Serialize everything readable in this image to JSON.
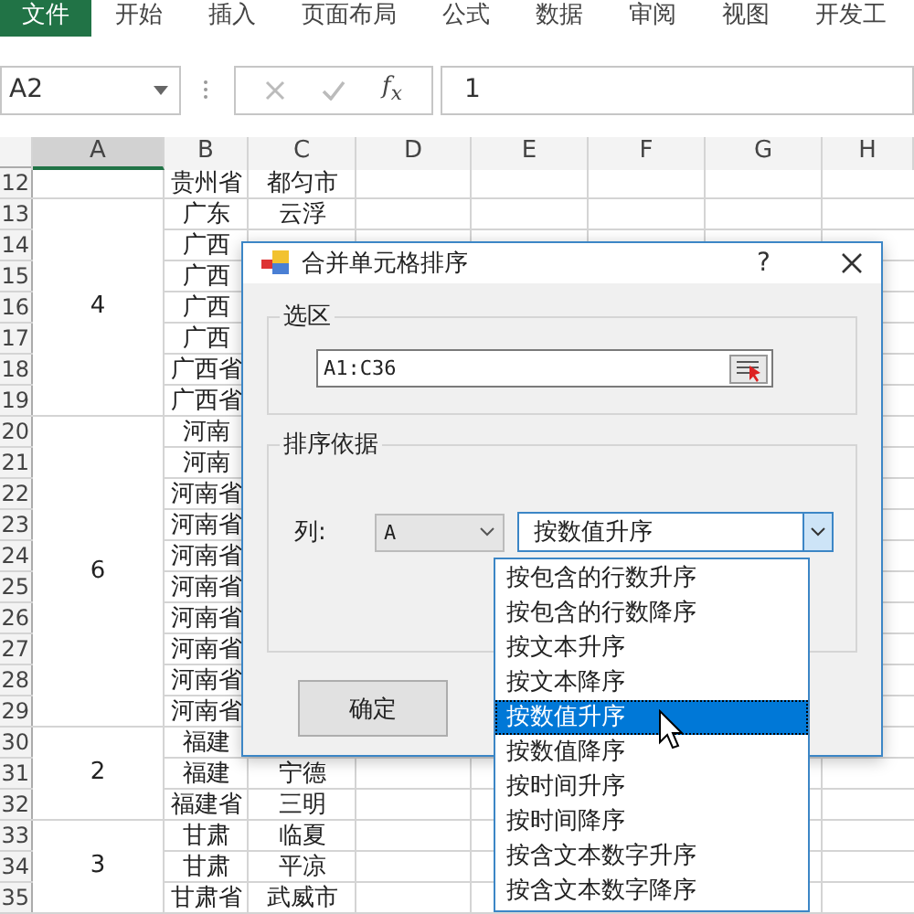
{
  "menu": [
    {
      "label": "文件",
      "selected": true
    },
    {
      "label": "开始",
      "selected": false
    },
    {
      "label": "插入",
      "selected": false
    },
    {
      "label": "页面布局",
      "selected": false
    },
    {
      "label": "公式",
      "selected": false
    },
    {
      "label": "数据",
      "selected": false
    },
    {
      "label": "审阅",
      "selected": false
    },
    {
      "label": "视图",
      "selected": false
    },
    {
      "label": "开发工",
      "selected": false
    }
  ],
  "formula_bar": {
    "name_box": "A2",
    "fx": "f$_{x}$",
    "value": "1"
  },
  "columns": [
    {
      "label": "A",
      "selected": true
    },
    {
      "label": "B",
      "selected": false
    },
    {
      "label": "C",
      "selected": false
    },
    {
      "label": "D",
      "selected": false
    },
    {
      "label": "E",
      "selected": false
    },
    {
      "label": "F",
      "selected": false
    },
    {
      "label": "G",
      "selected": false
    },
    {
      "label": "H",
      "selected": false
    }
  ],
  "rows": [
    {
      "number": "12",
      "b": "贵州省",
      "c": "都匀市"
    },
    {
      "number": "13",
      "a": "4",
      "b": "广东",
      "c": "云浮"
    },
    {
      "number": "14",
      "b": "广西"
    },
    {
      "number": "15",
      "b": "广西"
    },
    {
      "number": "16",
      "b": "广西"
    },
    {
      "number": "17",
      "b": "广西"
    },
    {
      "number": "18",
      "b": "广西省"
    },
    {
      "number": "19",
      "b": "广西省"
    },
    {
      "number": "20",
      "a": "6",
      "b": "河南"
    },
    {
      "number": "21",
      "b": "河南"
    },
    {
      "number": "22",
      "b": "河南省"
    },
    {
      "number": "23",
      "b": "河南省"
    },
    {
      "number": "24",
      "b": "河南省"
    },
    {
      "number": "25",
      "b": "河南省"
    },
    {
      "number": "26",
      "b": "河南省"
    },
    {
      "number": "27",
      "b": "河南省"
    },
    {
      "number": "28",
      "b": "河南省"
    },
    {
      "number": "29",
      "b": "河南省"
    },
    {
      "number": "30",
      "a": "2",
      "b": "福建"
    },
    {
      "number": "31",
      "b": "福建",
      "c": "宁德"
    },
    {
      "number": "32",
      "b": "福建省",
      "c": "三明"
    },
    {
      "number": "33",
      "a": "3",
      "b": "甘肃",
      "c": "临夏"
    },
    {
      "number": "34",
      "b": "甘肃",
      "c": "平凉"
    },
    {
      "number": "35",
      "b": "甘肃省",
      "c": "武威市"
    }
  ],
  "dialog": {
    "title": "合并单元格排序",
    "help": "?",
    "range_group": {
      "label": "选区",
      "value": "A1:C36"
    },
    "sort_group": {
      "label": "排序依据",
      "column_label": "列:",
      "column_value": "A",
      "order_value": "按数值升序"
    },
    "ok_button": "确定",
    "order_options": [
      {
        "label": "按包含的行数升序",
        "selected": false
      },
      {
        "label": "按包含的行数降序",
        "selected": false
      },
      {
        "label": "按文本升序",
        "selected": false
      },
      {
        "label": "按文本降序",
        "selected": false
      },
      {
        "label": "按数值升序",
        "selected": true
      },
      {
        "label": "按数值降序",
        "selected": false
      },
      {
        "label": "按时间升序",
        "selected": false
      },
      {
        "label": "按时间降序",
        "selected": false
      },
      {
        "label": "按含文本数字升序",
        "selected": false
      },
      {
        "label": "按含文本数字降序",
        "selected": false
      }
    ]
  }
}
